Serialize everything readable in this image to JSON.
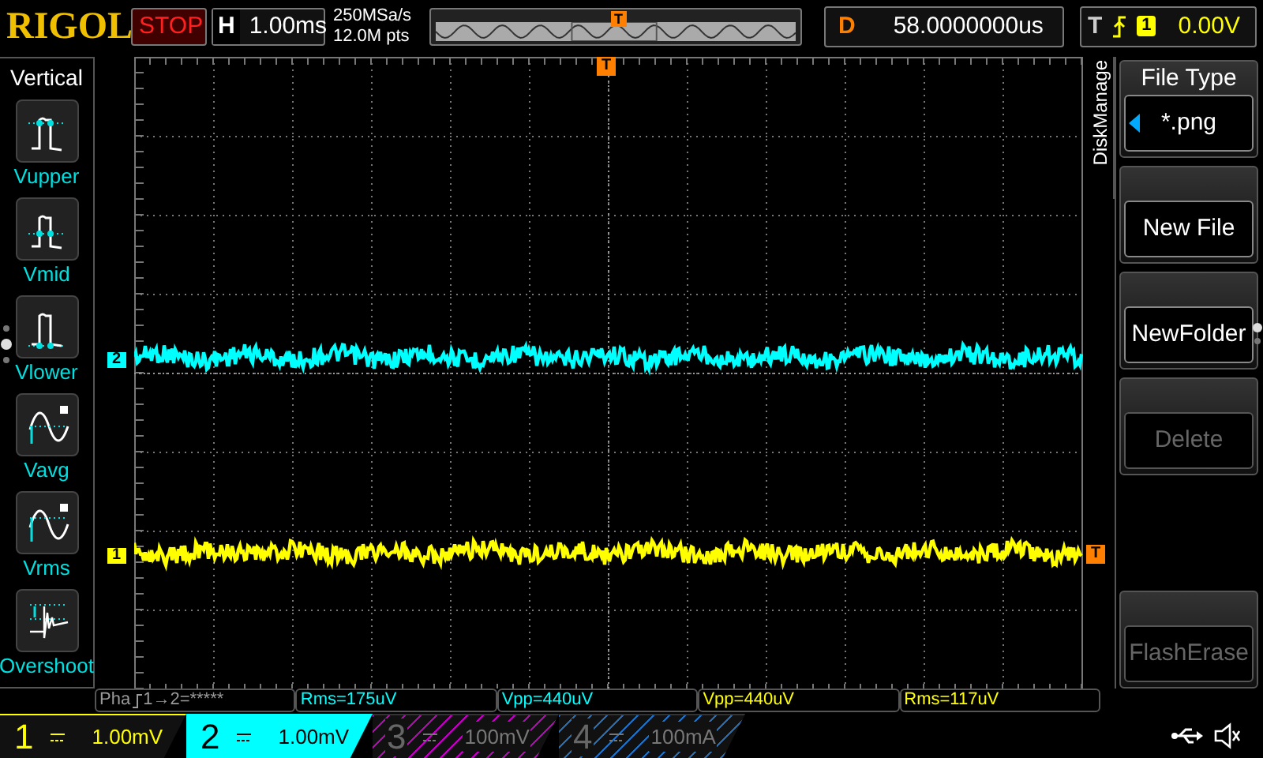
{
  "brand": "RIGOL",
  "run_state": {
    "label": "STOP"
  },
  "horizontal": {
    "label": "H",
    "value": "1.00ms"
  },
  "acquisition": {
    "sample_rate": "250MSa/s",
    "memory_depth": "12.0M pts"
  },
  "delay": {
    "label": "D",
    "value": "58.0000000us"
  },
  "trigger": {
    "label": "T",
    "source": "1",
    "level": "0.00V"
  },
  "left_menu": {
    "title": "Vertical",
    "items": [
      {
        "label": "Vupper",
        "kind": "vupper"
      },
      {
        "label": "Vmid",
        "kind": "vmid"
      },
      {
        "label": "Vlower",
        "kind": "vlower"
      },
      {
        "label": "Vavg",
        "kind": "vavg"
      },
      {
        "label": "Vrms",
        "kind": "vrms"
      },
      {
        "label": "Overshoot",
        "kind": "overshoot"
      }
    ]
  },
  "overview": {
    "trigger_marker": "T"
  },
  "display": {
    "trigger_position_marker": "T",
    "trigger_level_marker": "T",
    "traces": [
      {
        "marker": "2",
        "color": "#00ffff"
      },
      {
        "marker": "1",
        "color": "#ffff00"
      }
    ]
  },
  "right_menu": {
    "tab": "DiskManage",
    "items": [
      {
        "kind": "select",
        "title": "File Type",
        "value": "*.png",
        "disabled": false
      },
      {
        "kind": "button",
        "value": "New File",
        "disabled": false
      },
      {
        "kind": "button",
        "value": "NewFolder",
        "disabled": false
      },
      {
        "kind": "button",
        "value": "Delete",
        "disabled": true
      },
      {
        "kind": "button",
        "value": "FlashErase",
        "disabled": true
      }
    ]
  },
  "measurements": [
    {
      "kind": "phase",
      "text": "Pha",
      "value": "1→2=*****",
      "color": "#9a9a9a"
    },
    {
      "kind": "plain",
      "text": "Rms=175uV",
      "color": "#00ffff"
    },
    {
      "kind": "plain",
      "text": "Vpp=440uV",
      "color": "#00ffff"
    },
    {
      "kind": "plain",
      "text": "Vpp=440uV",
      "color": "#ffff00"
    },
    {
      "kind": "plain",
      "text": "Rms=117uV",
      "color": "#ffff00"
    }
  ],
  "channels": [
    {
      "number": "1",
      "scale": "1.00mV",
      "on": true,
      "selected": false,
      "color": "#ffff00"
    },
    {
      "number": "2",
      "scale": "1.00mV",
      "on": true,
      "selected": true,
      "color": "#00ffff"
    },
    {
      "number": "3",
      "scale": "100mV",
      "on": false,
      "selected": false,
      "color": "#c000c0"
    },
    {
      "number": "4",
      "scale": "100mA",
      "on": false,
      "selected": false,
      "color": "#2070c0"
    }
  ]
}
